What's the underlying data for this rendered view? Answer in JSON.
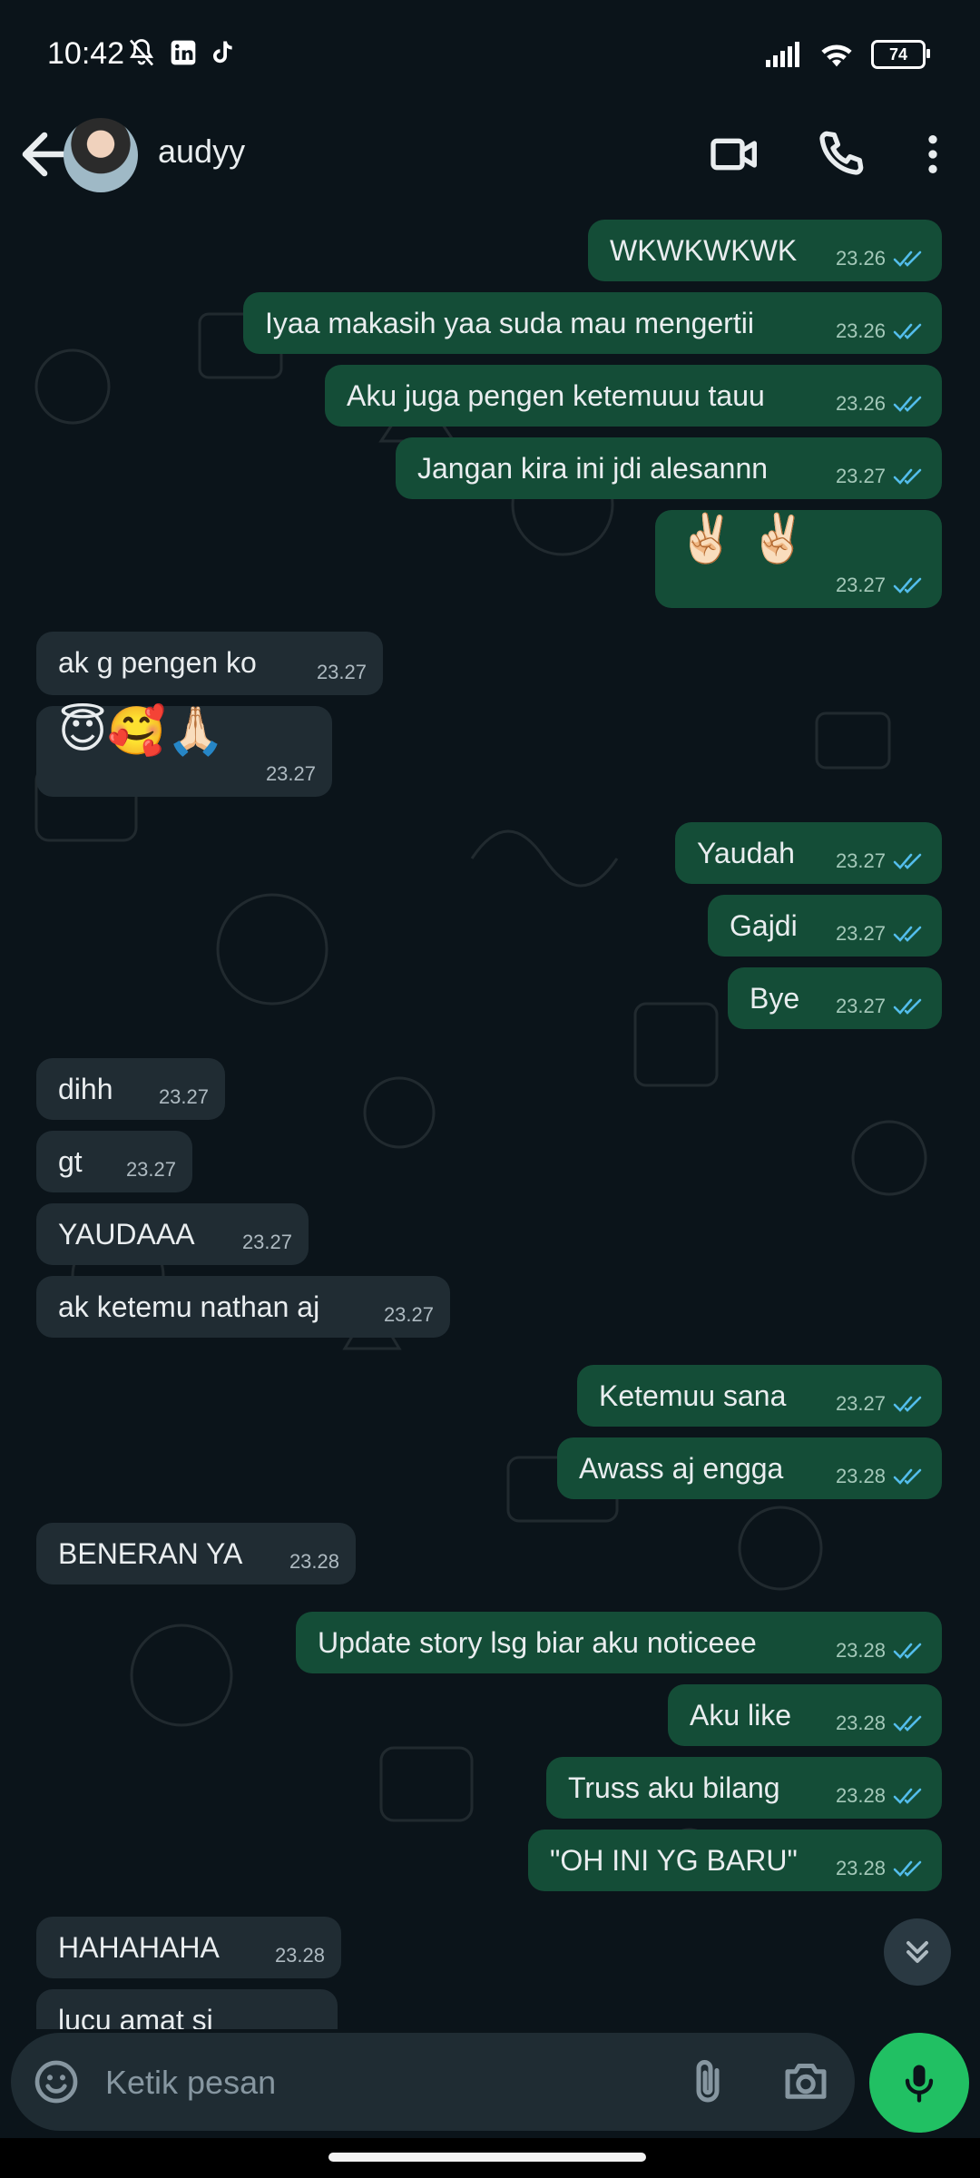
{
  "status_bar": {
    "time": "10:42",
    "battery": "74"
  },
  "header": {
    "contact_name": "audyy"
  },
  "messages": [
    {
      "dir": "out",
      "text": "WKWKWKWK",
      "time": "23.26"
    },
    {
      "dir": "out",
      "text": "Iyaa makasih yaa suda mau mengertii",
      "time": "23.26"
    },
    {
      "dir": "out",
      "text": "Aku juga pengen ketemuuu tauu",
      "time": "23.26"
    },
    {
      "dir": "out",
      "text": "Jangan kira ini jdi alesannn",
      "time": "23.27"
    },
    {
      "dir": "out",
      "text": "✌🏻 ✌🏻",
      "time": "23.27"
    },
    {
      "dir": "in",
      "text": "ak g pengen ko",
      "time": "23.27"
    },
    {
      "dir": "in",
      "text": "😇🥰🙏🏻",
      "time": "23.27"
    },
    {
      "dir": "out",
      "text": "Yaudah",
      "time": "23.27"
    },
    {
      "dir": "out",
      "text": "Gajdi",
      "time": "23.27"
    },
    {
      "dir": "out",
      "text": "Bye",
      "time": "23.27"
    },
    {
      "dir": "in",
      "text": "dihh",
      "time": "23.27"
    },
    {
      "dir": "in",
      "text": "gt",
      "time": "23.27"
    },
    {
      "dir": "in",
      "text": "YAUDAAA",
      "time": "23.27"
    },
    {
      "dir": "in",
      "text": "ak ketemu nathan aj",
      "time": "23.27"
    },
    {
      "dir": "out",
      "text": "Ketemuu sana",
      "time": "23.27"
    },
    {
      "dir": "out",
      "text": "Awass aj engga",
      "time": "23.28"
    },
    {
      "dir": "in",
      "text": "BENERAN YA",
      "time": "23.28"
    },
    {
      "dir": "out",
      "text": "Update story lsg biar aku noticeee",
      "time": "23.28"
    },
    {
      "dir": "out",
      "text": "Aku like",
      "time": "23.28"
    },
    {
      "dir": "out",
      "text": "Truss aku bilang",
      "time": "23.28"
    },
    {
      "dir": "out",
      "text": "\"OH INI YG BARU\"",
      "time": "23.28"
    },
    {
      "dir": "in",
      "text": "HAHAHAHA",
      "time": "23.28"
    },
    {
      "dir": "in",
      "text": "lucu amat si",
      "time": ""
    }
  ],
  "composer": {
    "placeholder": "Ketik pesan"
  },
  "colors": {
    "outgoing_bubble": "#144d37",
    "incoming_bubble": "#202c33",
    "background": "#0b141a",
    "tick_read": "#53bdeb",
    "mic_button": "#21c063"
  }
}
